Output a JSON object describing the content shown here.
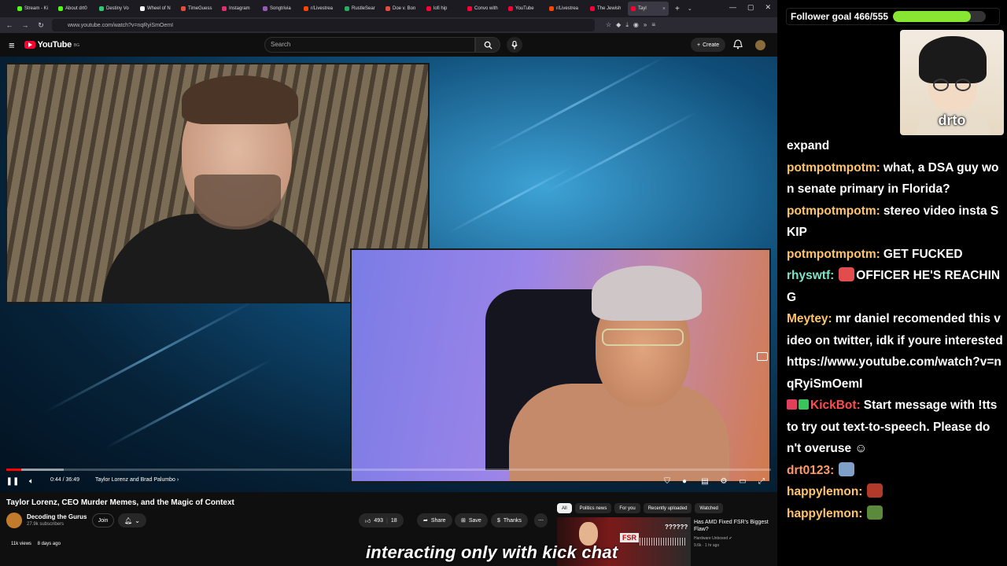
{
  "browser": {
    "tabs": [
      {
        "label": "Stream - Ki",
        "color": "#53fc18"
      },
      {
        "label": "About drt0",
        "color": "#53fc18"
      },
      {
        "label": "Destiny Vo",
        "color": "#2ecc71"
      },
      {
        "label": "Wheel of N",
        "color": "#ffffff"
      },
      {
        "label": "TimeGuess",
        "color": "#e74c3c"
      },
      {
        "label": "Instagram",
        "color": "#e1306c"
      },
      {
        "label": "Songtrivia",
        "color": "#9b59b6"
      },
      {
        "label": "r/Livestrea",
        "color": "#ff4500"
      },
      {
        "label": "RustleSear",
        "color": "#27ae60"
      },
      {
        "label": "Doe v. Bon",
        "color": "#e74c3c"
      },
      {
        "label": "lofi hip",
        "color": "#ff0033"
      },
      {
        "label": "Convo with",
        "color": "#ff0033"
      },
      {
        "label": "YouTube",
        "color": "#ff0033"
      },
      {
        "label": "r/Livestrea",
        "color": "#ff4500"
      },
      {
        "label": "The Jewish",
        "color": "#ff0033"
      },
      {
        "label": "Tayl",
        "color": "#ff0033",
        "active": true
      }
    ],
    "url": "www.youtube.com/watch?v=nqRyiSmOemI"
  },
  "youtube": {
    "logo_text": "YouTube",
    "country_code": "BG",
    "search_placeholder": "Search",
    "create_label": "Create"
  },
  "player": {
    "time": "0:44 / 36:49",
    "chapter": "Taylor Lorenz and Brad Palumbo",
    "played_fraction": 0.02,
    "loaded_fraction": 0.075
  },
  "video": {
    "title": "Taylor Lorenz, CEO Murder Memes, and the Magic of Context",
    "channel": "Decoding the Gurus",
    "subscribers": "27.9k subscribers",
    "join_label": "Join",
    "likes": "493",
    "dislikes": "18",
    "share_label": "Share",
    "save_label": "Save",
    "thanks_label": "Thanks",
    "views": "11k views",
    "age": "8 days ago"
  },
  "chips": [
    "All",
    "Politics news",
    "For you",
    "Recently uploaded",
    "Watched"
  ],
  "recommendation": {
    "title": "Has AMD Fixed FSR's Biggest Flaw?",
    "channel": "Hardware Unboxed",
    "meta": "9.6k · 1 hr ago",
    "thumb_text": "FSR",
    "thumb_overlay": "??????"
  },
  "caption": "interacting only with kick chat",
  "overlay": {
    "goal_label": "Follower goal 466/555",
    "goal_fraction": 0.84,
    "streamer_name": "drto"
  },
  "chat": [
    {
      "user": "",
      "text": "expand",
      "color": "#ffffff"
    },
    {
      "user": "potmpotmpotm:",
      "text": "what, a DSA guy won senate primary in Florida?",
      "color": "#ffc46b"
    },
    {
      "user": "potmpotmpotm:",
      "text": "stereo video insta SKIP",
      "color": "#ffc46b"
    },
    {
      "user": "potmpotmpotm:",
      "text": "GET FUCKED",
      "color": "#ffc46b"
    },
    {
      "user": "rhyswtf:",
      "text": "OFFICER HE'S REACHING",
      "color": "#7ee6c8",
      "emote": true
    },
    {
      "user": "Meytey:",
      "text": "mr daniel recomended this video on twitter, idk if youre interested https://www.youtube.com/watch?v=nqRyiSmOemI",
      "color": "#ffc46b"
    },
    {
      "user": "KickBot:",
      "text": "Start message with !tts to try out text-to-speech. Please don't overuse ☺",
      "color": "#ff4d4d",
      "badge": true
    },
    {
      "user": "drt0123:",
      "text": "",
      "color": "#ff9966",
      "emote": true
    },
    {
      "user": "happylemon:",
      "text": "",
      "color": "#ffc46b",
      "emote": true
    },
    {
      "user": "happylemon:",
      "text": "",
      "color": "#ffc46b",
      "emote": true
    }
  ]
}
